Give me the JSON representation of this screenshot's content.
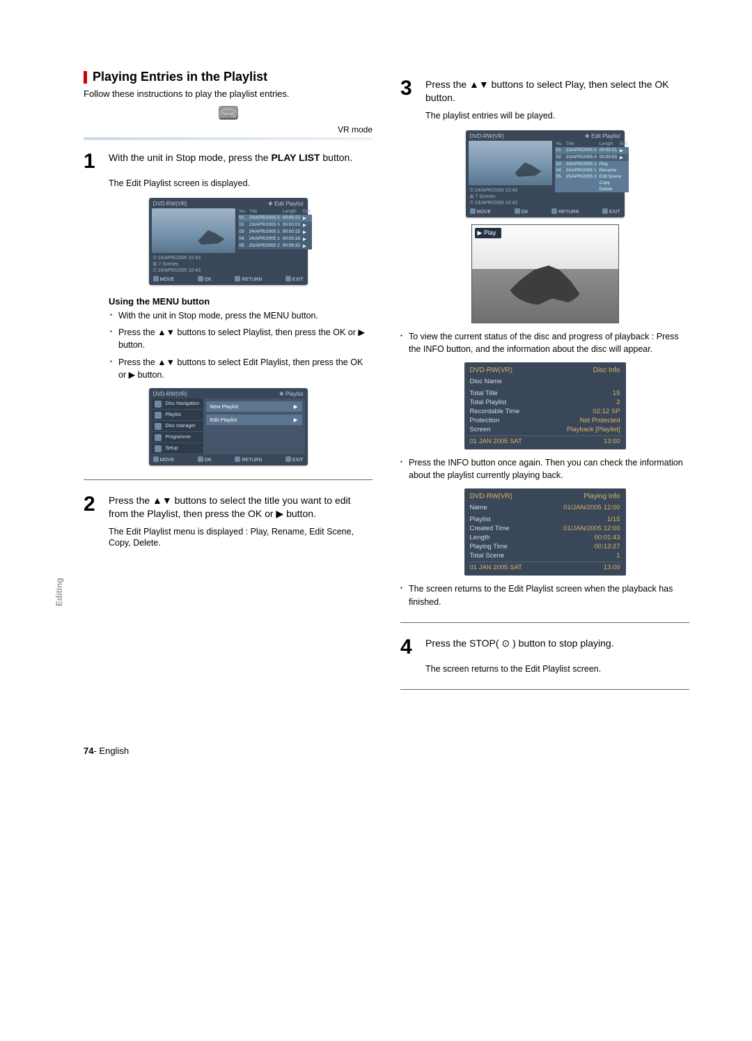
{
  "section_title": "Playing Entries in the Playlist",
  "intro": "Follow these instructions to play the playlist entries.",
  "dvd_icon_label": "DVD-RW",
  "vr_mode": "VR mode",
  "side_tab": "Editing",
  "page_number": "74",
  "page_lang": "English",
  "steps": {
    "s1": {
      "num": "1",
      "text_pre": "With the unit in Stop mode, press the ",
      "btn": "PLAY LIST",
      "text_post": " button.",
      "sub": "The Edit Playlist screen is displayed."
    },
    "s2": {
      "num": "2",
      "text": "Press the ▲▼ buttons to select the title you want to edit from the Playlist, then press the OK or ▶ button.",
      "sub": "The Edit Playlist menu is displayed : Play, Rename, Edit Scene, Copy, Delete."
    },
    "s3": {
      "num": "3",
      "text": "Press the ▲▼ buttons to select Play, then select the OK button.",
      "sub": "The playlist entries will be played."
    },
    "s4": {
      "num": "4",
      "text": "Press the STOP( ⊙ ) button to stop playing.",
      "sub": "The screen returns to the Edit Playlist screen."
    }
  },
  "menu_head": "Using the MENU button",
  "menu_bullets": [
    "With the unit in Stop mode, press the MENU button.",
    "Press the ▲▼ buttons to select Playlist, then press the OK or ▶ button.",
    "Press the ▲▼ buttons to select Edit Playlist, then press the OK or ▶ button."
  ],
  "col2_bullets": [
    "To view the current status of the disc and progress of playback : Press the INFO button, and the information about the disc will appear.",
    "Press the INFO button once again. Then you can check the information about the playlist currently playing back.",
    "The screen returns to the Edit Playlist screen when the playback has finished."
  ],
  "osd": {
    "disc_label": "DVD-RW(VR)",
    "edit_playlist": "Edit Playlist",
    "playlist_label": "Playlist",
    "date1": "24/APR/2005 10:43",
    "scenes": "7 Scenes",
    "date2": "24/APR/2005 10:43",
    "foot": {
      "move": "MOVE",
      "ok": "OK",
      "return": "RETURN",
      "exit": "EXIT"
    },
    "table1": {
      "head": [
        "No.",
        "Title",
        "Length",
        "Edit"
      ],
      "rows": [
        [
          "01",
          "23/APR/2005 0",
          "00:00:21",
          "▶"
        ],
        [
          "02",
          "23/APR/2005 0",
          "00:00:03",
          "▶"
        ],
        [
          "03",
          "24/APR/2005 1",
          "00:00:15",
          "▶"
        ],
        [
          "04",
          "24/APR/2005 1",
          "00:00:16",
          "▶"
        ],
        [
          "05",
          "25/APR/2005 2",
          "00:06:32",
          "▶"
        ]
      ]
    },
    "side_menu": [
      "Disc Navigation",
      "Playlist",
      "Disc manager",
      "Programme",
      "Setup"
    ],
    "main_opts": [
      "New Playlist",
      "Edit Playlist"
    ],
    "ctx_menu": [
      "Play",
      "Rename",
      "Edit Scene",
      "Copy",
      "Delete"
    ],
    "table3_rows": [
      [
        "01",
        "23/APR/2005 0",
        "00:00:21",
        "▶"
      ],
      [
        "02",
        "23/APR/2005 0",
        "00:00:03",
        "▶"
      ],
      [
        "03",
        "24/APR/2005 1",
        ""
      ],
      [
        "04",
        "24/APR/2005 1",
        ""
      ],
      [
        "05",
        "25/APR/2005 2",
        ""
      ]
    ],
    "play_tag": "▶ Play"
  },
  "disc_info": {
    "head_l": "DVD-RW(VR)",
    "head_r": "Disc Info",
    "rows": [
      [
        "Disc Name",
        ""
      ],
      [
        "Total Title",
        "15"
      ],
      [
        "Total Playlist",
        "2"
      ],
      [
        "Recordable Time",
        "02:12  SP"
      ],
      [
        "Protection",
        "Not Protected"
      ],
      [
        "Screen",
        "Playback [Playlist]"
      ]
    ],
    "foot_l": "01 JAN 2005 SAT",
    "foot_r": "13:00"
  },
  "playing_info": {
    "head_l": "DVD-RW(VR)",
    "head_r": "Playing Info",
    "rows": [
      [
        "Name",
        "01/JAN/2005 12:00"
      ],
      [
        "Playlist",
        "1/15"
      ],
      [
        "Created Time",
        "01/JAN/2005 12:00"
      ],
      [
        "Length",
        "00:01:43"
      ],
      [
        "Playing Time",
        "00:13:27"
      ],
      [
        "Total Scene",
        "1"
      ]
    ],
    "foot_l": "01 JAN 2005 SAT",
    "foot_r": "13:00"
  }
}
